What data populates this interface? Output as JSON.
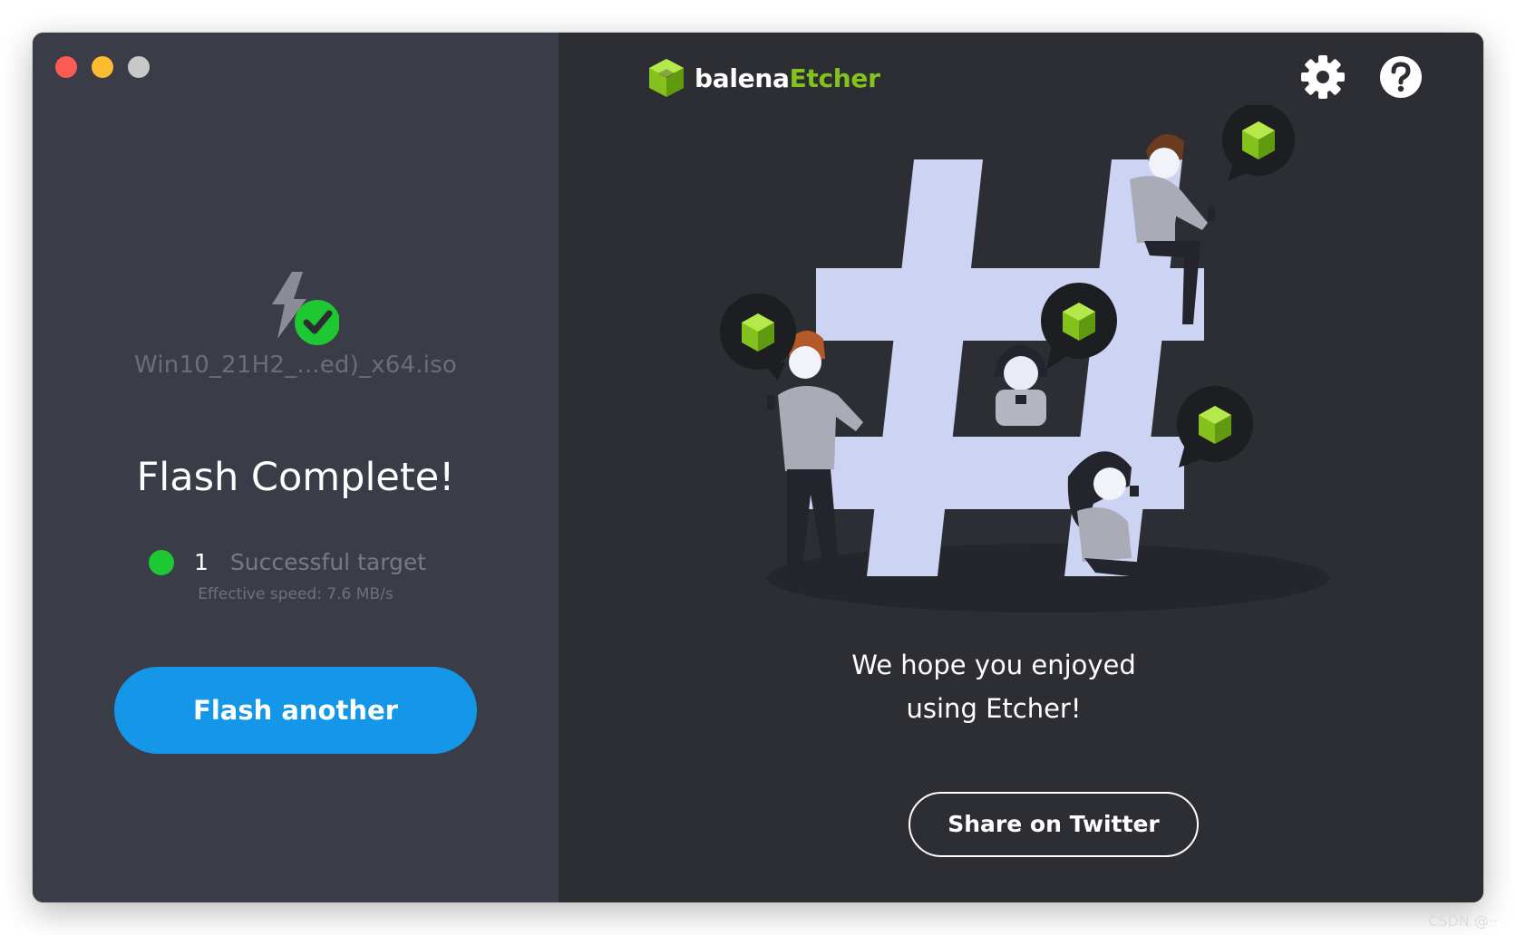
{
  "window": {
    "traffic_lights": [
      "close",
      "minimize",
      "zoom"
    ]
  },
  "left_panel": {
    "flash_icon": "lightning-bolt-with-check-icon",
    "image_name": "Win10_21H2_...ed)_x64.iso",
    "title": "Flash Complete!",
    "target_count": "1",
    "target_label": "Successful target",
    "speed": "Effective speed: 7.6 MB/s",
    "flash_another_label": "Flash another"
  },
  "header": {
    "logo_part1": "balena",
    "logo_part2": "Etcher",
    "settings_icon": "gear-icon",
    "help_icon": "question-icon"
  },
  "right_panel": {
    "message_line1": "We hope you enjoyed",
    "message_line2": "using Etcher!",
    "share_label": "Share on Twitter",
    "illustration": "people-around-hashtag-illustration"
  },
  "watermark": "CSDN @··",
  "colors": {
    "accent_blue": "#1496e9",
    "success_green": "#1ec832",
    "brand_green": "#85c11c",
    "left_bg": "#3a3d47",
    "right_bg": "#2d2e33"
  }
}
